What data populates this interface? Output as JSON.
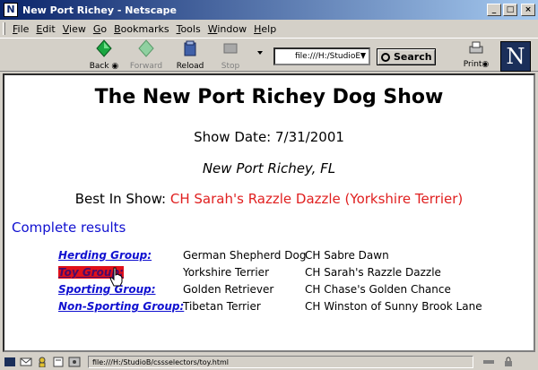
{
  "window": {
    "title": "New Port Richey - Netscape",
    "app_icon": "N"
  },
  "menu": [
    "File",
    "Edit",
    "View",
    "Go",
    "Bookmarks",
    "Tools",
    "Window",
    "Help"
  ],
  "toolbar": {
    "back": "Back",
    "forward": "Forward",
    "reload": "Reload",
    "stop": "Stop",
    "url": "file:///H:/StudioE",
    "search": "Search",
    "print": "Print",
    "logo": "N"
  },
  "page": {
    "title": "The New Port Richey Dog Show",
    "show_date": "Show Date: 7/31/2001",
    "location": "New Port Richey, FL",
    "best_label": "Best In Show:",
    "best_winner": "CH Sarah's Razzle Dazzle (Yorkshire Terrier)",
    "complete_link": "Complete results",
    "groups": [
      {
        "group": "Herding Group:",
        "breed": "German Shepherd Dog",
        "dog": "CH Sabre Dawn"
      },
      {
        "group": "Toy Group:",
        "breed": "Yorkshire Terrier",
        "dog": "CH Sarah's Razzle Dazzle"
      },
      {
        "group": "Sporting Group:",
        "breed": "Golden Retriever",
        "dog": "CH Chase's Golden Chance"
      },
      {
        "group": "Non-Sporting Group:",
        "breed": "Tibetan Terrier",
        "dog": "CH Winston of Sunny Brook Lane"
      }
    ]
  },
  "status": {
    "url": "file:///H:/StudioB/cssselectors/toy.html"
  },
  "colors": {
    "link": "#1010d0",
    "winner": "#e02020",
    "hover_bg": "#e0101a",
    "titlebar": "#0a246a"
  }
}
